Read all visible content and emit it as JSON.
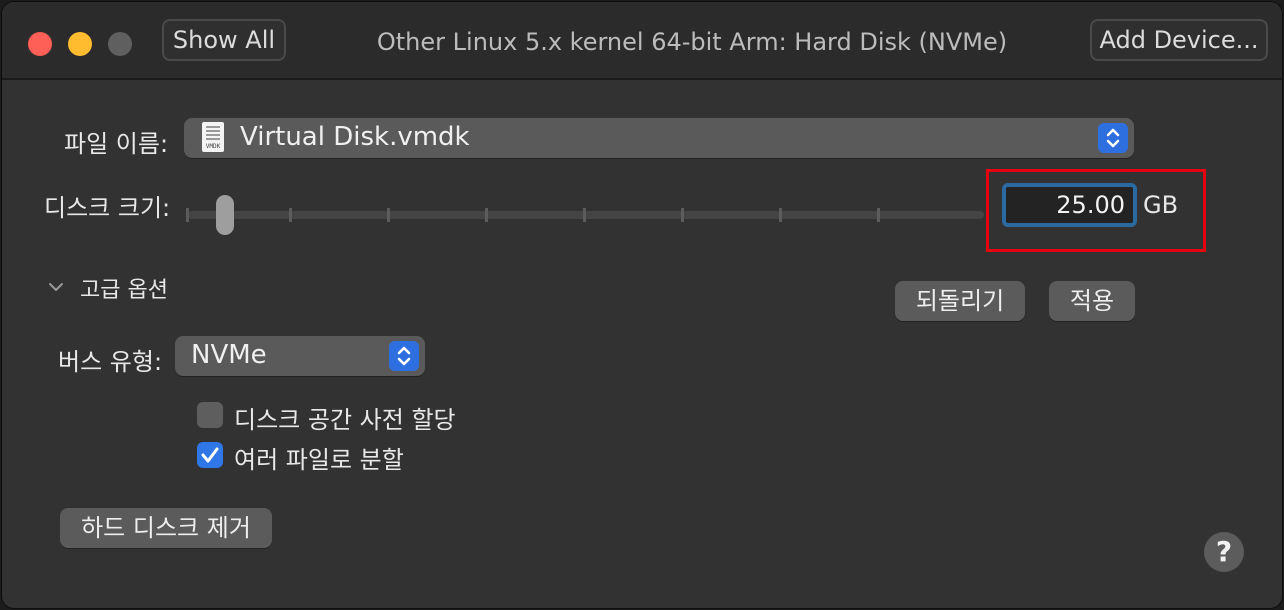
{
  "window": {
    "title": "Other Linux 5.x kernel 64-bit Arm: Hard Disk (NVMe)",
    "show_all": "Show All",
    "add_device": "Add Device..."
  },
  "file": {
    "label": "파일 이름:",
    "value": "Virtual Disk.vmdk",
    "icon_tag": "VMDK"
  },
  "disk_size": {
    "label": "디스크 크기:",
    "value": "25.00",
    "unit": "GB",
    "slider_fraction": 0.05
  },
  "advanced": {
    "label": "고급 옵션",
    "revert": "되돌리기",
    "apply": "적용"
  },
  "bus": {
    "label": "버스 유형:",
    "value": "NVMe"
  },
  "options": {
    "preallocate": {
      "label": "디스크 공간 사전 할당",
      "checked": false
    },
    "split": {
      "label": "여러 파일로 분할",
      "checked": true
    }
  },
  "remove_disk": "하드 디스크 제거",
  "help": "?",
  "colors": {
    "accent": "#2f76e6",
    "highlight": "#e4000f"
  }
}
